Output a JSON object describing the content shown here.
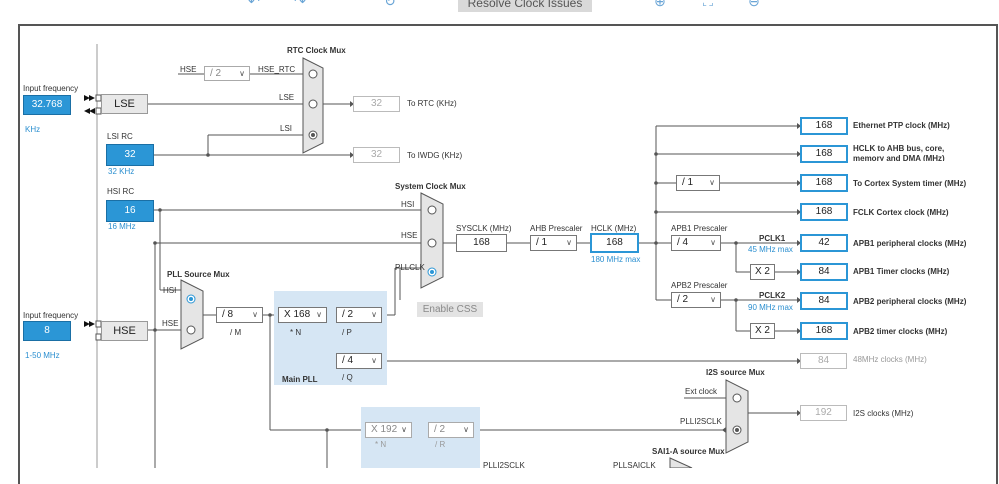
{
  "toolbar": {
    "resolve_label": "Resolve Clock Issues",
    "icons": [
      "undo-icon",
      "redo-icon",
      "refresh-icon",
      "zoom-in-icon",
      "fit-icon",
      "zoom-out-icon"
    ]
  },
  "inputs": {
    "lse": {
      "label": "Input frequency",
      "value": "32.768",
      "unit": "KHz",
      "name": "LSE"
    },
    "lsi": {
      "label": "LSI RC",
      "value": "32",
      "unit": "32 KHz"
    },
    "hsi": {
      "label": "HSI RC",
      "value": "16",
      "unit": "16 MHz"
    },
    "hse": {
      "label": "Input frequency",
      "value": "8",
      "unit": "1-50 MHz",
      "name": "HSE"
    }
  },
  "rtc": {
    "mux_label": "RTC Clock Mux",
    "hse_label": "HSE",
    "div_value": "/ 2",
    "hse_rtc_label": "HSE_RTC",
    "lse_label": "LSE",
    "lsi_label": "LSI",
    "rtc_out": "32",
    "rtc_out_label": "To RTC (KHz)",
    "iwdg_out": "32",
    "iwdg_out_label": "To IWDG (KHz)"
  },
  "sysclk": {
    "mux_label": "System Clock Mux",
    "hsi_label": "HSI",
    "hse_label": "HSE",
    "pllclk_label": "PLLCLK",
    "sysclk_label": "SYSCLK (MHz)",
    "sysclk_value": "168",
    "ahb_label": "AHB Prescaler",
    "ahb_value": "/ 1",
    "hclk_label": "HCLK (MHz)",
    "hclk_value": "168",
    "hclk_max": "180 MHz max",
    "enable_css": "Enable CSS"
  },
  "pll": {
    "source_mux_label": "PLL Source Mux",
    "hsi_label": "HSI",
    "hse_label": "HSE",
    "m_value": "/ 8",
    "m_label": "/ M",
    "n_value": "X 168",
    "n_label": "* N",
    "p_value": "/ 2",
    "p_label": "/ P",
    "q_value": "/ 4",
    "q_label": "/ Q",
    "main_label": "Main PLL"
  },
  "apb": {
    "apb1_label": "APB1 Prescaler",
    "apb1_value": "/ 4",
    "pclk1_label": "PCLK1",
    "pclk1_max": "45 MHz max",
    "apb1_timer_mult": "X 2",
    "apb2_label": "APB2 Prescaler",
    "apb2_value": "/ 2",
    "pclk2_label": "PCLK2",
    "pclk2_max": "90 MHz max",
    "apb2_timer_mult": "X 2",
    "cortex_div": "/ 1"
  },
  "outputs": [
    {
      "value": "168",
      "label": "Ethernet PTP clock (MHz)"
    },
    {
      "value": "168",
      "label": "HCLK to AHB bus, core, memory and DMA (MHz)"
    },
    {
      "value": "168",
      "label": "To Cortex System timer (MHz)"
    },
    {
      "value": "168",
      "label": "FCLK Cortex clock (MHz)"
    },
    {
      "value": "42",
      "label": "APB1 peripheral clocks (MHz)"
    },
    {
      "value": "84",
      "label": "APB1 Timer clocks (MHz)"
    },
    {
      "value": "84",
      "label": "APB2 peripheral clocks (MHz)"
    },
    {
      "value": "168",
      "label": "APB2 timer clocks (MHz)"
    }
  ],
  "usb48": {
    "value": "84",
    "label": "48MHz clocks (MHz)"
  },
  "i2s": {
    "mux_label": "I2S source Mux",
    "ext_label": "Ext clock",
    "plli2s_label": "PLLI2SCLK",
    "value": "192",
    "label": "I2S clocks (MHz)",
    "n_value": "X 192",
    "n_label": "* N",
    "r_value": "/ 2",
    "r_label": "/ R"
  },
  "sai": {
    "mux_label": "SAI1-A source Mux",
    "plli2s_label": "PLLI2SCLK",
    "pllsai_label": "PLLSAICLK"
  }
}
